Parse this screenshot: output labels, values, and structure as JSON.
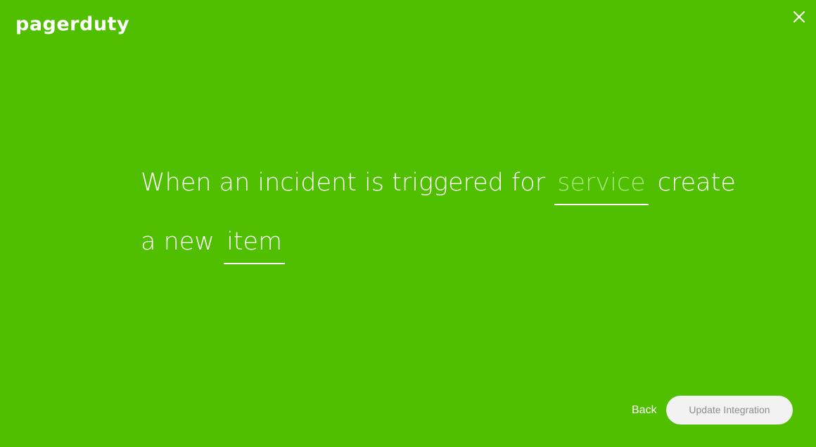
{
  "brand": {
    "logo_text": "pagerduty"
  },
  "colors": {
    "background": "#4fbf00",
    "placeholder_text": "#a7e57f",
    "button_background": "#f2f2f2",
    "button_text": "#8c8c8c"
  },
  "header": {
    "close_icon": "close-icon"
  },
  "recipe": {
    "line1_text": "When an incident is triggered for",
    "service_slot": "service",
    "line1_suffix": "create",
    "line2_text": "a new",
    "item_slot": "item"
  },
  "footer": {
    "back_label": "Back",
    "submit_label": "Update Integration"
  }
}
